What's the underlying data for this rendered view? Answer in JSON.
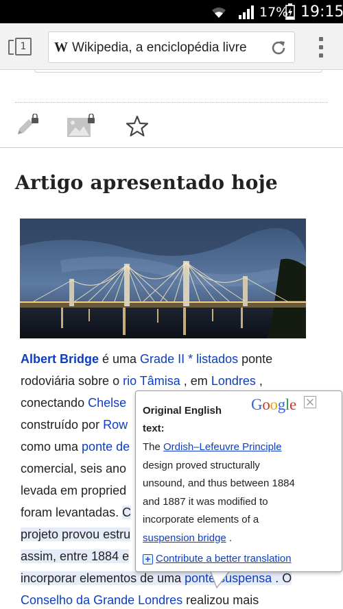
{
  "status_bar": {
    "battery_percent": "17%",
    "time": "19:15",
    "icons": [
      "wifi-icon",
      "signal-icon",
      "battery-charging-icon"
    ]
  },
  "browser": {
    "tab_count": "1",
    "url": "Wikipedia, a enciclopédia livre",
    "site_icon": "W",
    "icons": [
      "tabs-icon",
      "reload-icon",
      "overflow-menu-icon"
    ]
  },
  "page_actions": {
    "icons": [
      "edit-locked-icon",
      "upload-image-locked-icon",
      "watch-star-icon"
    ]
  },
  "section": {
    "title": "Artigo apresentado hoje"
  },
  "article": {
    "line1": {
      "bold_link": "Albert Bridge",
      "t1": " é uma ",
      "link1": "Grade II * listados",
      "t2": " ponte"
    },
    "line2": {
      "t1": "rodoviária sobre o ",
      "link1": "rio Tâmisa",
      "t2": " , em ",
      "link2": "Londres",
      "t3": " ,"
    },
    "line3": {
      "t1": "conectando ",
      "link1": "Chelse"
    },
    "line4": {
      "t1": "construído por ",
      "link1": "Row"
    },
    "line5": {
      "t1": "como uma ",
      "link1": "ponte de"
    },
    "line6": {
      "t1": "comercial, seis ano"
    },
    "line7": {
      "t1": "levada em propried"
    },
    "line8": {
      "t1": "foram levantadas. ",
      "hl1": "C"
    },
    "line9": {
      "hl1": "projeto provou estru"
    },
    "line10": {
      "hl1": "assim, entre 1884 e"
    },
    "line11": {
      "hl1": "incorporar elementos de uma ",
      "hl_link": "ponte suspensa",
      "hl2": " . O"
    },
    "line12": {
      "link1": "Conselho da Grande Londres",
      "t1": " realizou mais"
    }
  },
  "translation_popup": {
    "heading": "Original English text:",
    "logo": "Google",
    "body": {
      "l1_t": "The ",
      "l1_link": "Ordish–Lefeuvre Principle",
      "l2": "design proved structurally",
      "l3": "unsound, and thus between 1884",
      "l4": "and 1887 it was modified to",
      "l5": "incorporate elements of a",
      "l6_link": "suspension bridge",
      "l6_t": " ."
    },
    "contribute": "Contribute a better translation",
    "icons": [
      "close-icon",
      "plus-icon"
    ]
  }
}
